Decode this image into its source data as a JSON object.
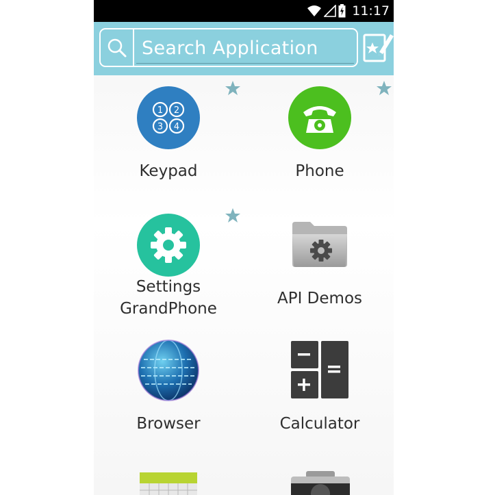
{
  "status_bar": {
    "time": "11:17"
  },
  "search": {
    "placeholder": "Search Application"
  },
  "apps": [
    {
      "label": "Keypad",
      "favorite": true,
      "icon": "keypad-icon"
    },
    {
      "label": "Phone",
      "favorite": true,
      "icon": "phone-icon"
    },
    {
      "label": "Settings GrandPhone",
      "line1": "Settings",
      "line2": "GrandPhone",
      "favorite": true,
      "icon": "settings-gear-icon"
    },
    {
      "label": "API Demos",
      "favorite": false,
      "icon": "folder-gear-icon"
    },
    {
      "label": "Browser",
      "favorite": false,
      "icon": "globe-icon"
    },
    {
      "label": "Calculator",
      "favorite": false,
      "icon": "calculator-icon"
    }
  ],
  "colors": {
    "search_bar": "#8bd0de",
    "star": "#7fb3bd",
    "keypad": "#2f7fc1",
    "phone": "#4cbf1f",
    "settings": "#26c29e"
  }
}
